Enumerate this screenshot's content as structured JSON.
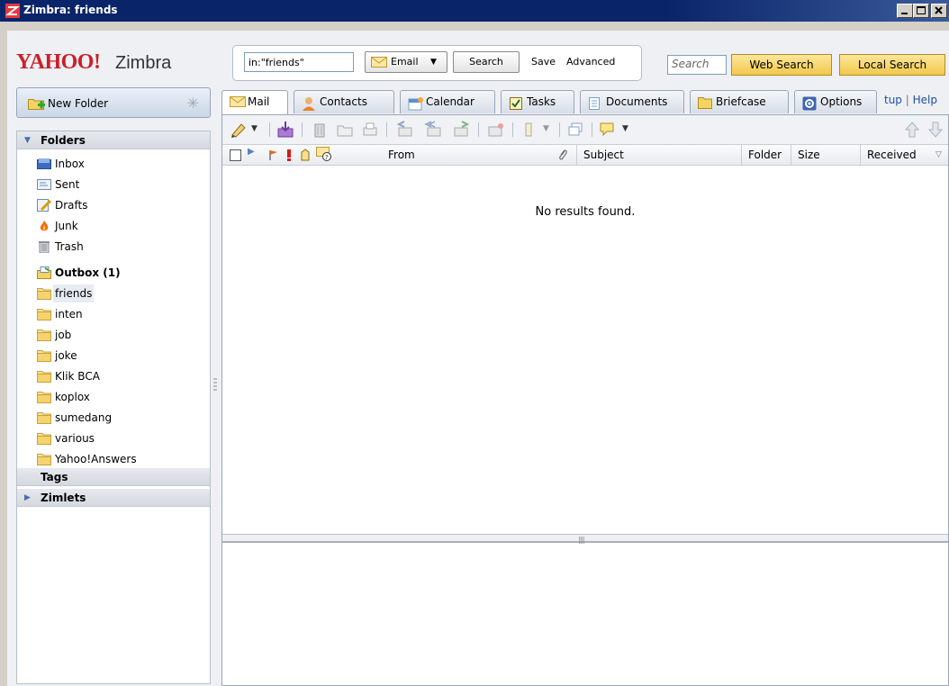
{
  "window": {
    "title": "Zimbra: friends"
  },
  "logo": {
    "yahoo": "YAHOO!",
    "zimbra": "Zimbra"
  },
  "search": {
    "query": "in:\"friends\"",
    "type_label": "Email",
    "search_label": "Search",
    "save_label": "Save",
    "advanced_label": "Advanced",
    "web_placeholder": "Search",
    "web_search_label": "Web Search",
    "local_search_label": "Local Search"
  },
  "sidebar": {
    "new_folder_label": "New Folder",
    "folders_header": "Folders",
    "folders": [
      {
        "label": "Inbox",
        "icon": "inbox-icon"
      },
      {
        "label": "Sent",
        "icon": "sent-icon"
      },
      {
        "label": "Drafts",
        "icon": "drafts-icon"
      },
      {
        "label": "Junk",
        "icon": "junk-icon"
      },
      {
        "label": "Trash",
        "icon": "trash-icon"
      },
      {
        "label": "Outbox (1)",
        "icon": "outbox-icon"
      },
      {
        "label": "friends",
        "icon": "folder-icon"
      },
      {
        "label": "inten",
        "icon": "folder-icon"
      },
      {
        "label": "job",
        "icon": "folder-icon"
      },
      {
        "label": "joke",
        "icon": "folder-icon"
      },
      {
        "label": "Klik BCA",
        "icon": "folder-icon"
      },
      {
        "label": "koplox",
        "icon": "folder-icon"
      },
      {
        "label": "sumedang",
        "icon": "folder-icon"
      },
      {
        "label": "various",
        "icon": "folder-icon"
      },
      {
        "label": "Yahoo!Answers",
        "icon": "folder-icon"
      }
    ],
    "tags_header": "Tags",
    "zimlets_header": "Zimlets"
  },
  "tabs": [
    {
      "label": "Mail",
      "icon": "mail-icon",
      "active": true
    },
    {
      "label": "Contacts",
      "icon": "contacts-icon"
    },
    {
      "label": "Calendar",
      "icon": "calendar-icon"
    },
    {
      "label": "Tasks",
      "icon": "tasks-icon"
    },
    {
      "label": "Documents",
      "icon": "documents-icon"
    },
    {
      "label": "Briefcase",
      "icon": "briefcase-icon"
    },
    {
      "label": "Options",
      "icon": "options-icon"
    }
  ],
  "help_links": {
    "setup": "tup",
    "separator": "|",
    "help": "Help"
  },
  "list": {
    "columns": [
      "From",
      "Subject",
      "Folder",
      "Size",
      "Received"
    ],
    "empty_message": "No results found."
  },
  "colors": {
    "title_bar": "#0a246a",
    "yahoo_red": "#cc1f27",
    "accent_yellow": "#f1c84a"
  }
}
